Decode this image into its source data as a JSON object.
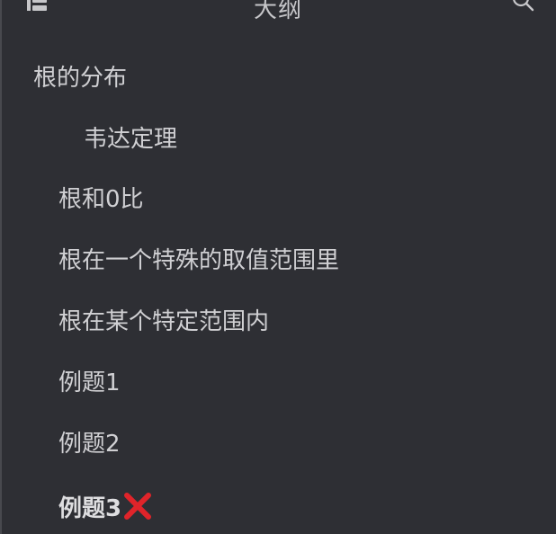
{
  "header": {
    "title": "大纲",
    "toggle_icon": "sidebar-toggle-icon",
    "search_icon": "search-icon"
  },
  "outline": {
    "items": [
      {
        "label": "根的分布",
        "level": 1
      },
      {
        "label": "韦达定理",
        "level": 3
      },
      {
        "label": "根和0比",
        "level": 2
      },
      {
        "label": "根在一个特殊的取值范围里",
        "level": 2
      },
      {
        "label": "根在某个特定范围内",
        "level": 2
      },
      {
        "label": "例题1",
        "level": 2
      },
      {
        "label": "例题2",
        "level": 2
      },
      {
        "label": "例题3",
        "level": 2,
        "active": true,
        "marker": "cross-mark"
      }
    ]
  },
  "colors": {
    "background": "#2e2f34",
    "text": "#d0d0d3",
    "cross": "#e0242a"
  }
}
